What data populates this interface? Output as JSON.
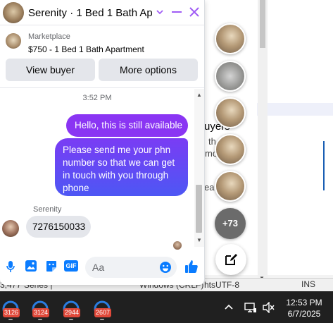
{
  "colors": {
    "accent": "#a05cf5",
    "bubble_primary": "#8a35f3",
    "bubble_gradient_top": "#7a3cf4",
    "bubble_gradient_bottom": "#4d57f4",
    "messenger_blue": "#0a7cff",
    "taskbar": "#202020",
    "badge": "#e0493a"
  },
  "background_app": {
    "fragments": [
      "uyers",
      "th",
      "mo",
      "ea",
      "hts",
      "Windows (CRLF)",
      "UTF-8",
      "INS"
    ],
    "status_left": "3,477 ",
    "status_mid": "Series | ",
    "status_enc": "Windows (CRLF)",
    "status_utf": "UTF-8",
    "status_ins": "INS"
  },
  "chat_heads": {
    "icons": [
      "room-photo",
      "room-photo-gray",
      "room-photo",
      "room-photo",
      "room-photo"
    ],
    "more_count": "+73",
    "compose_icon": "new-message-icon"
  },
  "chat": {
    "title": "Serenity · 1 Bed 1 Bath Apa...",
    "marketplace_label": "Marketplace",
    "listing": "$750 - 1 Bed 1 Bath Apartment",
    "buttons": {
      "view_buyer": "View buyer",
      "more_options": "More options"
    },
    "timestamp": "3:52 PM",
    "messages": {
      "out_1": "Hello, this is still available",
      "out_2": "Please send me your phn number so that we can get in touch with you through phone",
      "sender": "Serenity",
      "in_1": "7276150033"
    },
    "composer": {
      "placeholder": "Aa",
      "icons": [
        "microphone-icon",
        "photo-icon",
        "sticker-icon",
        "gif-icon",
        "emoji-icon",
        "like-icon"
      ],
      "gif_label": "GIF"
    }
  },
  "taskbar": {
    "apps": [
      {
        "icon": "app-icon",
        "badge": "3126"
      },
      {
        "icon": "app-icon",
        "badge": "3124"
      },
      {
        "icon": "app-icon",
        "badge": "2944"
      },
      {
        "icon": "app-icon",
        "badge": "2607"
      }
    ],
    "clock_time": "12:53 PM",
    "clock_date": "6/7/2025"
  }
}
